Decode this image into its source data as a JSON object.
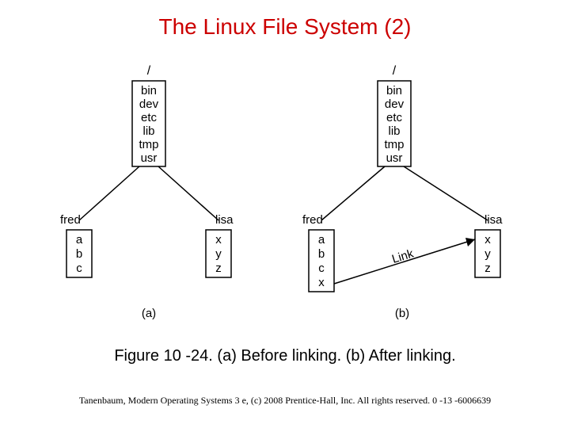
{
  "title": "The Linux File System (2)",
  "caption": "Figure 10 -24. (a) Before linking. (b) After linking.",
  "footer": "Tanenbaum, Modern Operating Systems 3 e, (c) 2008 Prentice-Hall, Inc. All rights reserved. 0 -13 -6006639",
  "fig": {
    "root": "/",
    "dirs": {
      "l1": "bin",
      "l2": "dev",
      "l3": "etc",
      "l4": "lib",
      "l5": "tmp",
      "l6": "usr"
    },
    "user_fred": "fred",
    "user_lisa": "lisa",
    "fred_a": {
      "l1": "a",
      "l2": "b",
      "l3": "c"
    },
    "fred_b": {
      "l1": "a",
      "l2": "b",
      "l3": "c",
      "l4": "x"
    },
    "lisa": {
      "l1": "x",
      "l2": "y",
      "l3": "z"
    },
    "panel_a": "(a)",
    "panel_b": "(b)",
    "link_label": "Link"
  }
}
